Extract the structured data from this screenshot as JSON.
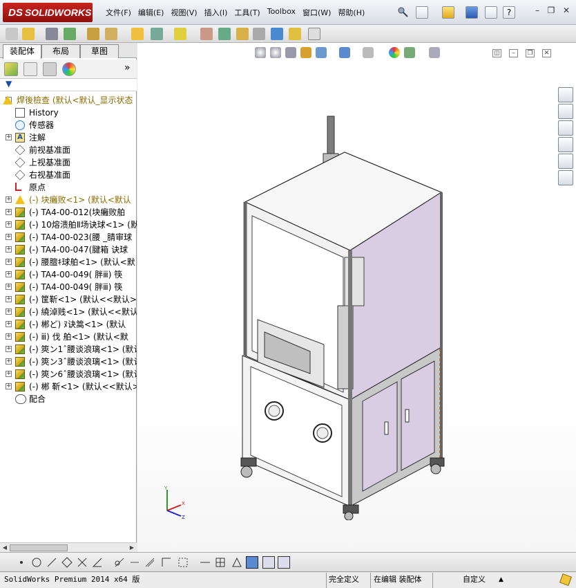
{
  "app": {
    "logo_text": "SOLIDWORKS",
    "logo_prefix": "DS",
    "menu": [
      "文件(F)",
      "编辑(E)",
      "视图(V)",
      "插入(I)",
      "工具(T)",
      "Toolbox",
      "窗口(W)",
      "帮助(H)"
    ]
  },
  "left_panel": {
    "tabs": [
      "装配体",
      "布局",
      "草图"
    ],
    "active_tab": "装配体",
    "filter_label": "▼",
    "expand_more": "»",
    "tree": [
      {
        "label": "焊後檢查  (默认<默认_显示状态",
        "icon": "warn",
        "level": 0,
        "expand": "-"
      },
      {
        "label": "History",
        "icon": "hist",
        "level": 1,
        "expand": ""
      },
      {
        "label": "传感器",
        "icon": "sens",
        "level": 1,
        "expand": ""
      },
      {
        "label": "注解",
        "icon": "ann",
        "level": 1,
        "expand": "+"
      },
      {
        "label": "前视基准面",
        "icon": "plane",
        "level": 1,
        "expand": ""
      },
      {
        "label": "上视基准面",
        "icon": "plane",
        "level": 1,
        "expand": ""
      },
      {
        "label": "右视基准面",
        "icon": "plane",
        "level": 1,
        "expand": ""
      },
      {
        "label": "原点",
        "icon": "origin",
        "level": 1,
        "expand": ""
      },
      {
        "label": "(-) 块癱败<1> (默认<默认",
        "icon": "warn",
        "level": 1,
        "expand": "+"
      },
      {
        "label": "(-) TA4-00-012(块癱败舶  ",
        "icon": "part",
        "level": 1,
        "expand": "+"
      },
      {
        "label": "(-) 10熔溃舶Ⅱ场诀球<1> (默",
        "icon": "part",
        "level": 1,
        "expand": "+"
      },
      {
        "label": "(-) TA4-00-023(腰  _腈审球",
        "icon": "part",
        "level": 1,
        "expand": "+"
      },
      {
        "label": "(-) TA4-00-047(腱箱  诀球",
        "icon": "part",
        "level": 1,
        "expand": "+"
      },
      {
        "label": "(-) 腰膻ｷ球舶<1> (默认<默",
        "icon": "part",
        "level": 1,
        "expand": "+"
      },
      {
        "label": "(-) TA4-00-049(  胖ⅲ) 筷",
        "icon": "part",
        "level": 1,
        "expand": "+"
      },
      {
        "label": "(-) TA4-00-049(  胖ⅲ) 筷",
        "icon": "part",
        "level": 1,
        "expand": "+"
      },
      {
        "label": "(-) 筐靳<1> (默认<<默认>_显",
        "icon": "part",
        "level": 1,
        "expand": "+"
      },
      {
        "label": "(-) 繞淖贱<1> (默认<<默认>",
        "icon": "part",
        "level": 1,
        "expand": "+"
      },
      {
        "label": "(-) 郴ど) ﾇ诀篙<1> (默认",
        "icon": "part",
        "level": 1,
        "expand": "+"
      },
      {
        "label": "(-) ⅲ) 伐  舶<1> (默认<默",
        "icon": "part",
        "level": 1,
        "expand": "+"
      },
      {
        "label": "(-) 筴ン1ˆ腰谈浪璃<1> (默认",
        "icon": "part",
        "level": 1,
        "expand": "+"
      },
      {
        "label": "(-) 筴ン3ˆ腰谈浪璃<1> (默认",
        "icon": "part",
        "level": 1,
        "expand": "+"
      },
      {
        "label": "(-) 筴ン6ˆ腰谈浪璃<1> (默认",
        "icon": "part",
        "level": 1,
        "expand": "+"
      },
      {
        "label": "(-) 郴  靳<1> (默认<<默认>",
        "icon": "part",
        "level": 1,
        "expand": "+"
      },
      {
        "label": "配合",
        "icon": "mate",
        "level": 1,
        "expand": ""
      }
    ]
  },
  "status": {
    "product": "SolidWorks Premium 2014 x64 版",
    "definition": "完全定义",
    "editing": "在编辑 装配体",
    "units": "自定义",
    "units_arrow": "▲"
  },
  "colors": {
    "panel_purple": "#d8cde2",
    "frame_gray": "#c4c4c4",
    "accent_orange": "#e07a20",
    "menu_text": "#111111"
  }
}
